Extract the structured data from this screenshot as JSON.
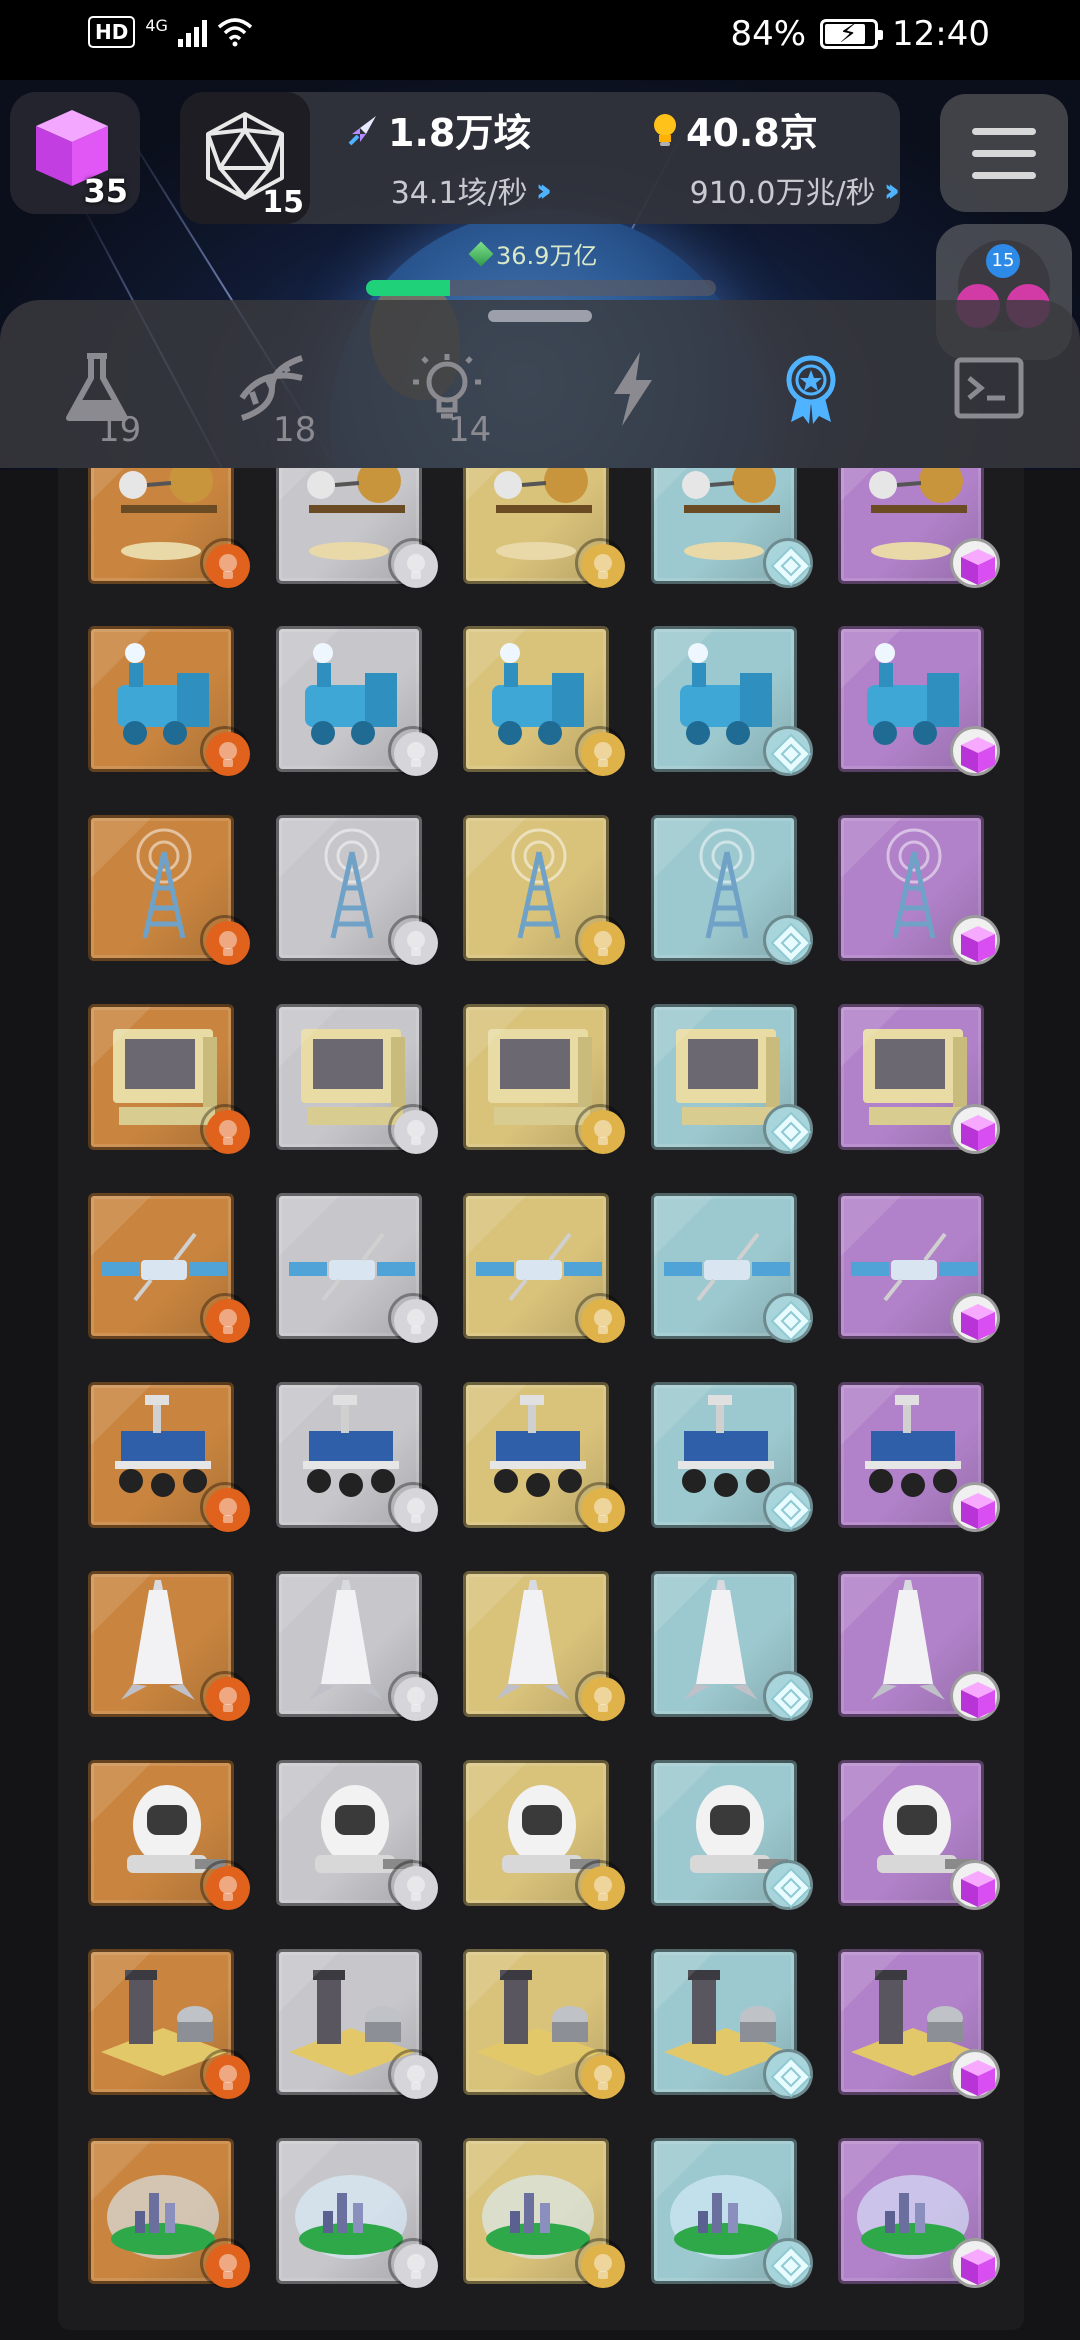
{
  "status_bar": {
    "hd_label": "HD",
    "network_label": "4G",
    "battery_percent": "84%",
    "battery_level": 0.84,
    "time": "12:40"
  },
  "header": {
    "cube_count": "35",
    "d20_count": "15",
    "stat_a_value": "1.8万垓",
    "stat_a_rate": "34.1垓/秒",
    "stat_b_value": "40.8京",
    "stat_b_rate": "910.0万兆/秒",
    "gem_value": "36.9万亿",
    "progress_fraction": 0.24,
    "avatar_badge": "15"
  },
  "tabs": [
    {
      "name": "flask",
      "icon": "flask-icon",
      "count": "19",
      "active": false
    },
    {
      "name": "dna",
      "icon": "dna-icon",
      "count": "18",
      "active": false
    },
    {
      "name": "idea",
      "icon": "lightbulb-icon",
      "count": "14",
      "active": false
    },
    {
      "name": "energy",
      "icon": "lightning-icon",
      "count": "",
      "active": false
    },
    {
      "name": "achievements",
      "icon": "medal-ribbon-icon",
      "count": "",
      "active": true
    },
    {
      "name": "terminal",
      "icon": "terminal-icon",
      "count": "",
      "active": false
    }
  ],
  "colors": {
    "tier_bronze": "#c9853f",
    "tier_silver": "#c7c7cb",
    "tier_gold": "#d9c27a",
    "tier_diamond": "#9cc9cf",
    "tier_purple": "#b181c9",
    "active_tab": "#4fb3ff",
    "progress": "#1fd27a",
    "cube": "#d84ef0"
  },
  "tiers": [
    "bronze",
    "silver",
    "gold",
    "diamond",
    "purple"
  ],
  "items": [
    {
      "name": "orrery",
      "icon": "orrery-icon"
    },
    {
      "name": "steam-locomotive",
      "icon": "locomotive-icon"
    },
    {
      "name": "radio-tower",
      "icon": "radio-tower-icon"
    },
    {
      "name": "computer",
      "icon": "computer-icon"
    },
    {
      "name": "satellite",
      "icon": "satellite-icon"
    },
    {
      "name": "mars-rover",
      "icon": "rover-icon"
    },
    {
      "name": "rocket",
      "icon": "rocket-icon"
    },
    {
      "name": "space-helmet",
      "icon": "helmet-icon"
    },
    {
      "name": "industrial-base",
      "icon": "factory-icon"
    },
    {
      "name": "dome-habitat",
      "icon": "dome-icon"
    }
  ]
}
